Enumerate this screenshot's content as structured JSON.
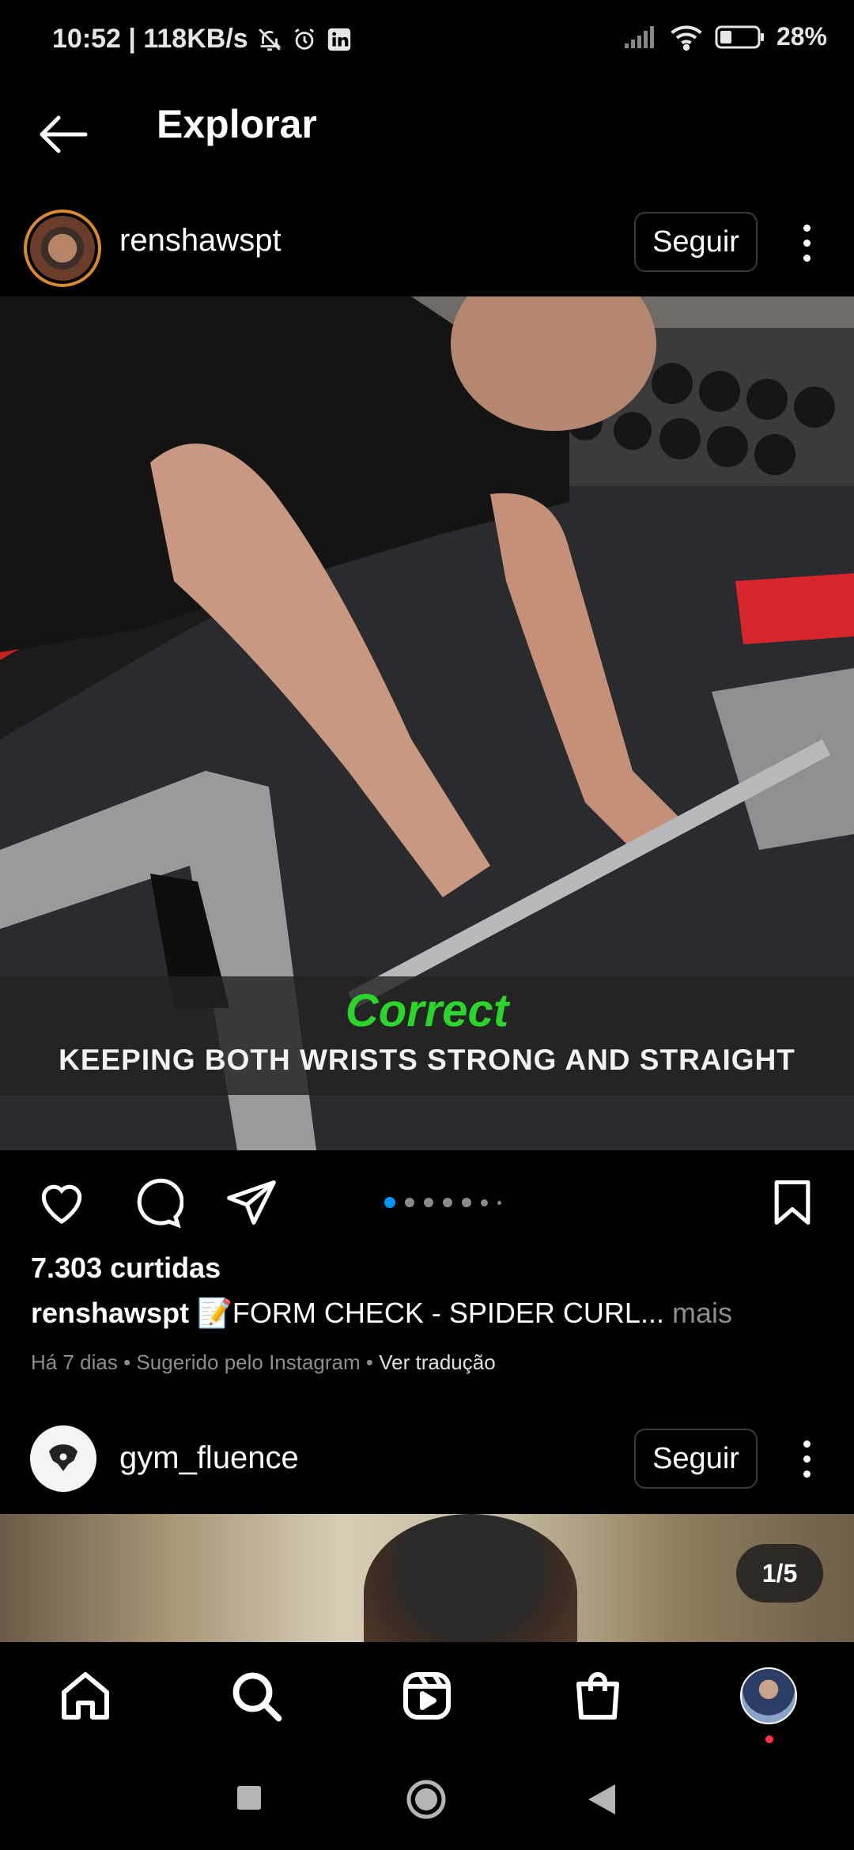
{
  "status_bar": {
    "time_speed": "10:52 | 118KB/s",
    "battery": "28%",
    "icons": [
      "bell-off-icon",
      "alarm-icon",
      "linkedin-icon",
      "signal-icon",
      "wifi-icon",
      "battery-icon"
    ]
  },
  "header": {
    "title": "Explorar",
    "back_icon": "arrow-left-icon"
  },
  "post1": {
    "username": "renshawspt",
    "follow_label": "Seguir",
    "media_caption_title": "Correct",
    "media_caption_subtitle": "KEEPING BOTH WRISTS STRONG AND STRAIGHT",
    "carousel": {
      "count": 7,
      "active_index": 0
    },
    "likes": "7.303 curtidas",
    "caption_user": "renshawspt",
    "caption_text": "📝FORM CHECK - SPIDER CURL...",
    "caption_more": " mais",
    "meta_text": "Há 7 dias • Sugerido pelo Instagram • ",
    "translate_label": "Ver tradução"
  },
  "post2": {
    "username": "gym_fluence",
    "follow_label": "Seguir",
    "counter": "1/5"
  },
  "bottom_nav": {
    "items": [
      "home-icon",
      "search-icon",
      "reels-icon",
      "shop-icon",
      "profile-avatar"
    ]
  },
  "colors": {
    "background": "#000000",
    "text": "#ffffff",
    "muted": "#8e8e8e",
    "accent_blue": "#0095f6",
    "caption_green": "#2bd52b",
    "notification_red": "#ff3040"
  }
}
